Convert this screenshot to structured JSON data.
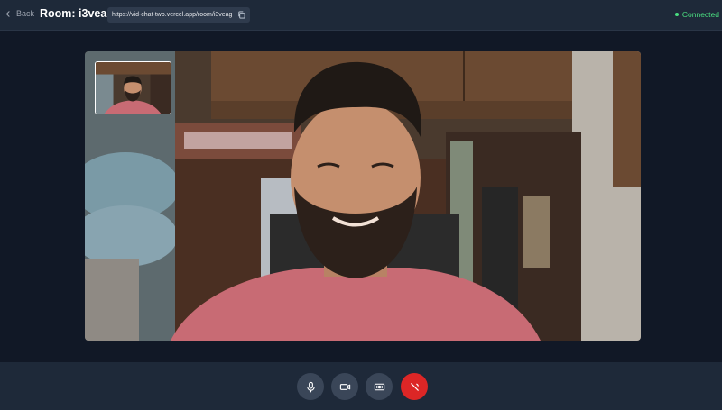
{
  "header": {
    "back_label": "Back",
    "room_title": "Room: i3veag",
    "room_url": "https://vid-chat-two.vercel.app/room/i3veag",
    "status_text": "Connected"
  },
  "video": {
    "main_feed_icon": "remote-participant-video",
    "self_view_icon": "local-self-view-video"
  },
  "controls": {
    "items": [
      {
        "name": "microphone",
        "icon": "mic-icon"
      },
      {
        "name": "camera",
        "icon": "video-icon"
      },
      {
        "name": "screen-share",
        "icon": "screen-share-icon"
      },
      {
        "name": "end-call",
        "icon": "phone-off-icon"
      }
    ]
  },
  "colors": {
    "background": "#161f2e",
    "bar": "#1e2939",
    "status": "#4ade80",
    "end_call": "#dc2626",
    "control": "#3a4658"
  }
}
